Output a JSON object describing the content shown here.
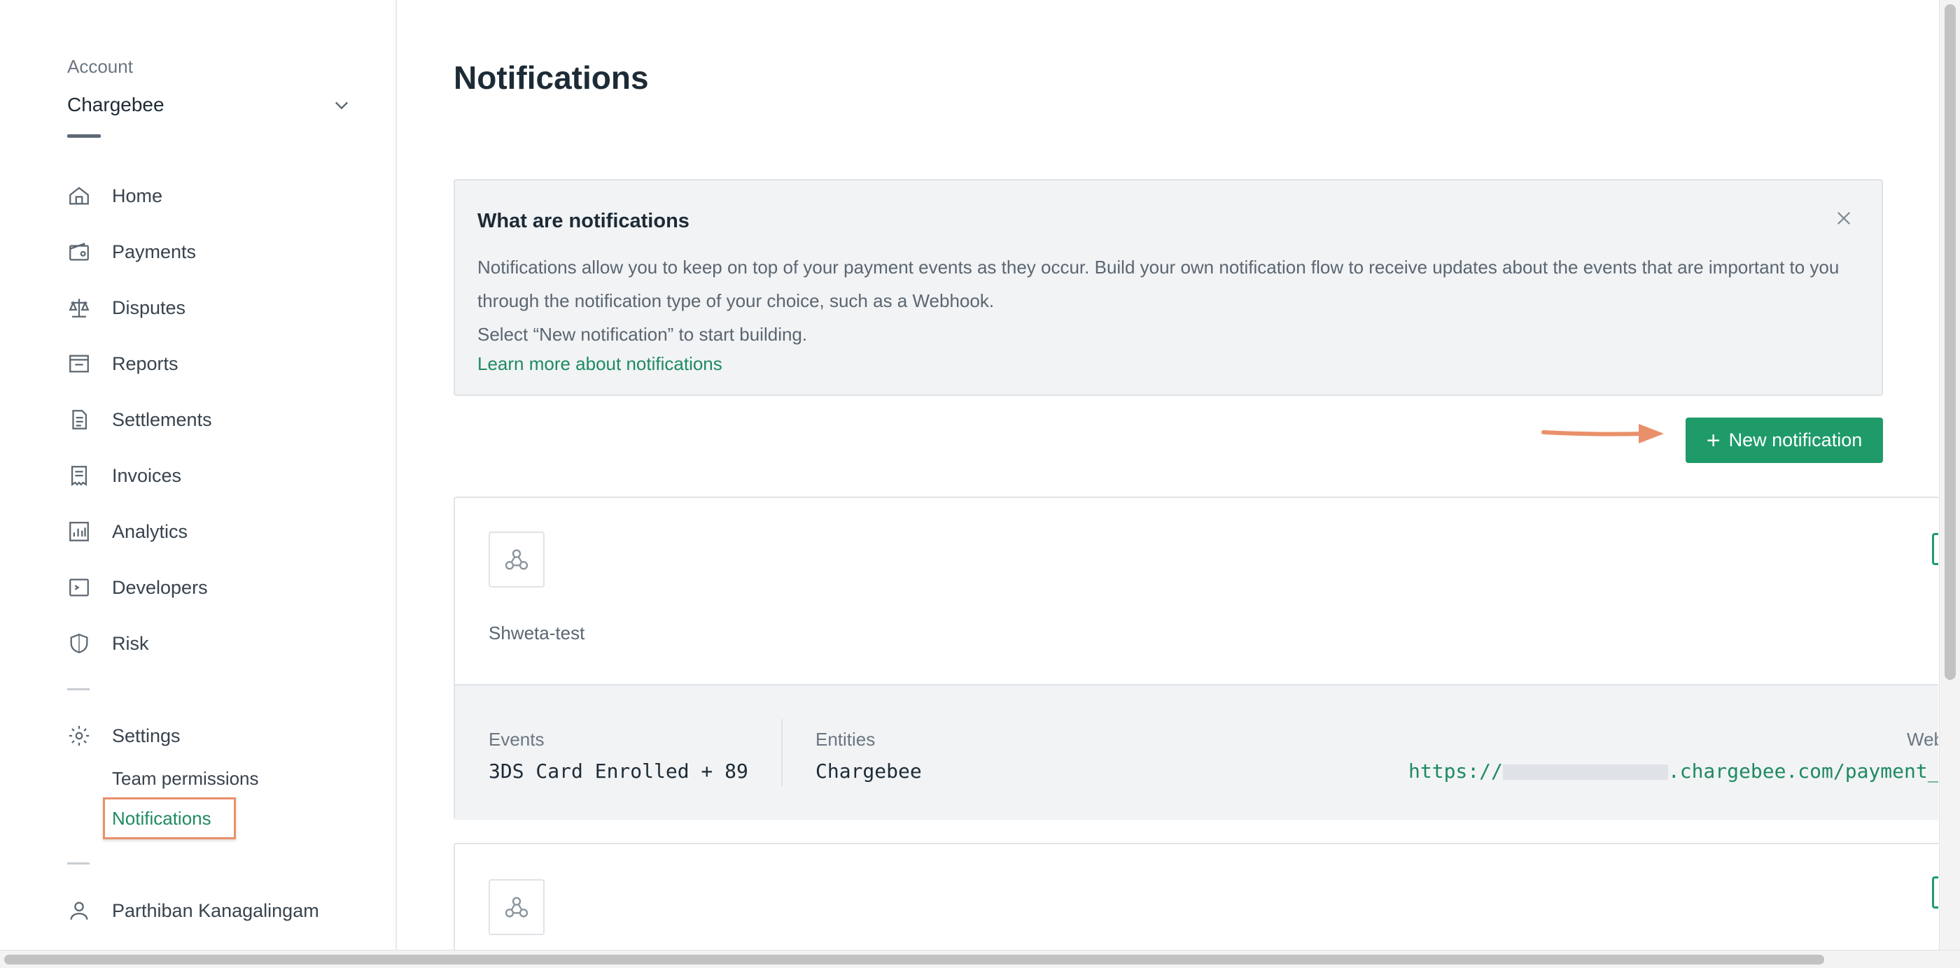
{
  "sidebar": {
    "account_label": "Account",
    "account_name": "Chargebee",
    "nav": [
      {
        "label": "Home",
        "icon": "home-icon"
      },
      {
        "label": "Payments",
        "icon": "wallet-icon"
      },
      {
        "label": "Disputes",
        "icon": "scales-icon"
      },
      {
        "label": "Reports",
        "icon": "inbox-icon"
      },
      {
        "label": "Settlements",
        "icon": "document-icon"
      },
      {
        "label": "Invoices",
        "icon": "receipt-icon"
      },
      {
        "label": "Analytics",
        "icon": "chart-icon"
      },
      {
        "label": "Developers",
        "icon": "code-icon"
      },
      {
        "label": "Risk",
        "icon": "shield-icon"
      }
    ],
    "settings_label": "Settings",
    "sub_items": {
      "team_permissions": "Team permissions",
      "notifications": "Notifications"
    },
    "user_name": "Parthiban Kanagalingam"
  },
  "main": {
    "title": "Notifications",
    "info": {
      "title": "What are notifications",
      "body": "Notifications allow you to keep on top of your payment events as they occur. Build your own notification flow to receive updates about the events that are important to you through the notification type of your choice, such as a Webhook.",
      "body2": "Select “New notification” to start building.",
      "link": "Learn more about notifications"
    },
    "new_button": "New notification",
    "card": {
      "name": "Shweta-test",
      "events_label": "Events",
      "events_value": "3DS Card Enrolled + 89",
      "entities_label": "Entities",
      "entities_value": "Chargebee",
      "webhook_label": "Web",
      "url_prefix": "https://",
      "url_suffix": ".chargebee.com/payment_"
    }
  },
  "colors": {
    "accent": "#1f9b6a",
    "link": "#1f8a60",
    "highlight": "#e9906a"
  }
}
